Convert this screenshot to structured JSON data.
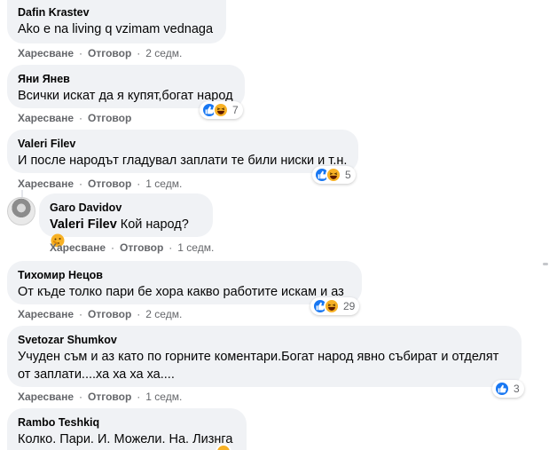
{
  "labels": {
    "like": "Харесване",
    "reply": "Отговор",
    "dot": "·"
  },
  "colors": {
    "bubble": "#f0f2f5",
    "meta": "#65676b",
    "like_blue": "#1877f2",
    "haha_yellow": "#f7b125"
  },
  "comments": [
    {
      "author": "Dafin Krastev",
      "text": "Ako e na living q vzimam vednaga",
      "time": "2 седм."
    },
    {
      "author": "Яни Янев",
      "text": "Всички искат да я купят,богат народ",
      "time": "",
      "reactions": {
        "icons": [
          "like-icon",
          "haha-icon"
        ],
        "count": "7"
      }
    },
    {
      "author": "Valeri Filev",
      "text": "И после народът гладувал заплати те били ниски и т.н.",
      "time": "1 седм.",
      "reactions": {
        "icons": [
          "like-icon",
          "haha-icon"
        ],
        "count": "5"
      }
    },
    {
      "author": "Garo Davidov",
      "mention": "Valeri Filev",
      "text": "Кой народ?",
      "emoji": "thinking-face-icon",
      "time": "1 седм."
    },
    {
      "author": "Тихомир Нецов",
      "text": "От къде толко пари бе хора какво работите искам и аз",
      "time": "2 седм.",
      "reactions": {
        "icons": [
          "like-icon",
          "haha-icon"
        ],
        "count": "29"
      }
    },
    {
      "author": "Svetozar Shumkov",
      "text_line1": "Учуден съм и аз като по горните коментари.Богат народ явно събират и отделят",
      "text_line2": "от заплати....ха ха ха ха....",
      "time": "1 седм.",
      "reactions": {
        "icons": [
          "like-icon"
        ],
        "count": "3"
      }
    },
    {
      "author": "Rambo Teshkiq",
      "text": "Колко. Пари. И. Можели. На. Лизнга"
    }
  ]
}
